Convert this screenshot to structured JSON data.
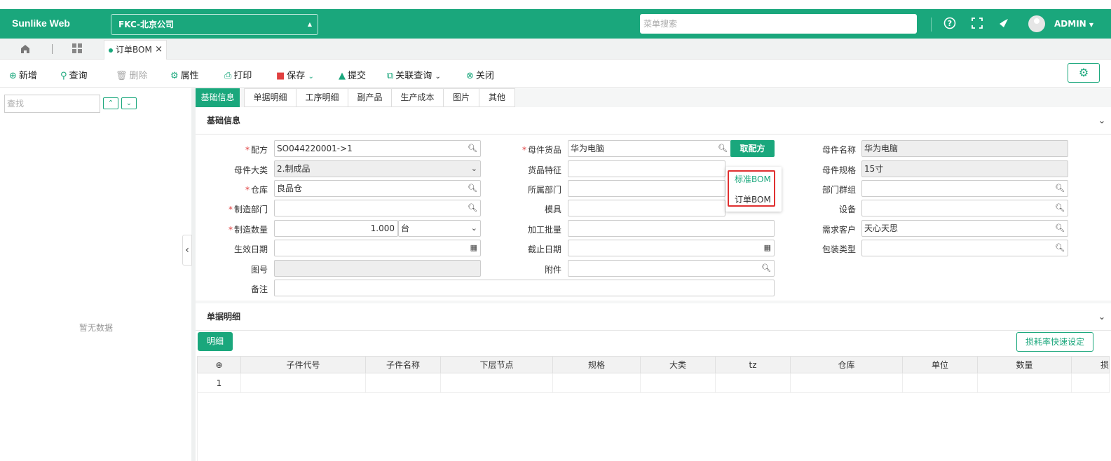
{
  "app": {
    "brand": "Sunlike Web",
    "company": "FKC-北京公司",
    "search_placeholder": "菜单搜索",
    "user": "ADMIN"
  },
  "tabs": {
    "doc_tab": "订单BOM"
  },
  "toolbar": {
    "new": "新增",
    "query": "查询",
    "delete": "删除",
    "props": "属性",
    "print": "打印",
    "save": "保存",
    "submit": "提交",
    "related": "关联查询",
    "close": "关闭"
  },
  "left": {
    "find_placeholder": "查找",
    "no_data": "暂无数据"
  },
  "subtabs": [
    "基础信息",
    "单据明细",
    "工序明细",
    "副产品",
    "生产成本",
    "图片",
    "其他"
  ],
  "basic": {
    "section_title": "基础信息",
    "formula_label": "配方",
    "formula_value": "SO044220001->1",
    "parent_item_label": "母件货品",
    "parent_item_value": "华为电脑",
    "get_formula_btn": "取配方",
    "parent_name_label": "母件名称",
    "parent_name_value": "华为电脑",
    "parent_cat_label": "母件大类",
    "parent_cat_value": "2.制成品",
    "item_feature_label": "货品特征",
    "parent_spec_label": "母件规格",
    "parent_spec_value": "15寸",
    "warehouse_label": "仓库",
    "warehouse_value": "良品仓",
    "dept_label": "所属部门",
    "dept_group_label": "部门群组",
    "mfg_dept_label": "制造部门",
    "mold_label": "模具",
    "equip_label": "设备",
    "mfg_qty_label": "制造数量",
    "mfg_qty_value": "1.000",
    "unit_value": "台",
    "batch_label": "加工批量",
    "customer_label": "需求客户",
    "customer_value": "天心天思",
    "eff_date_label": "生效日期",
    "end_date_label": "截止日期",
    "pack_label": "包装类型",
    "drawing_label": "图号",
    "attach_label": "附件",
    "remark_label": "备注"
  },
  "dropdown": {
    "std_bom": "标准BOM",
    "order_bom": "订单BOM"
  },
  "detail": {
    "section_title": "单据明细",
    "detail_btn": "明细",
    "quick_set": "损耗率快速设定",
    "columns": [
      "子件代号",
      "子件名称",
      "下层节点",
      "规格",
      "大类",
      "tz",
      "仓库",
      "单位",
      "数量",
      "损"
    ],
    "rows": [
      {
        "no": "1"
      }
    ]
  },
  "colors": {
    "accent": "#1aa77c",
    "highlight": "#e03030"
  }
}
